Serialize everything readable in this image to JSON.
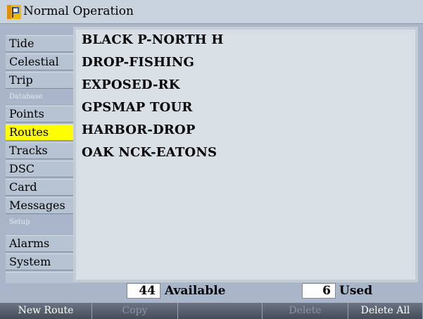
{
  "title": {
    "text": "Normal Operation",
    "icon": "garmin-flag-icon"
  },
  "sidebar": {
    "items": [
      {
        "label": "Tide",
        "selected": false
      },
      {
        "label": "Celestial",
        "selected": false
      },
      {
        "label": "Trip",
        "selected": false
      },
      {
        "header": "Database"
      },
      {
        "label": "Points",
        "selected": false
      },
      {
        "label": "Routes",
        "selected": true
      },
      {
        "label": "Tracks",
        "selected": false
      },
      {
        "label": "DSC",
        "selected": false
      },
      {
        "label": "Card",
        "selected": false
      },
      {
        "label": "Messages",
        "selected": false
      },
      {
        "header": "Setup"
      },
      {
        "label": "Alarms",
        "selected": false
      },
      {
        "label": "System",
        "selected": false
      }
    ]
  },
  "routes": [
    "BLACK P-NORTH H",
    "DROP-FISHING",
    "EXPOSED-RK",
    "GPSMAP TOUR",
    "HARBOR-DROP",
    "OAK NCK-EATONS"
  ],
  "status": {
    "available_count": "44",
    "available_label": "Available",
    "used_count": "6",
    "used_label": "Used"
  },
  "softkeys": [
    {
      "label": "New Route",
      "enabled": true
    },
    {
      "label": "Copy",
      "enabled": false
    },
    {
      "label": "",
      "enabled": false
    },
    {
      "label": "Delete",
      "enabled": false
    },
    {
      "label": "Delete All",
      "enabled": true
    }
  ],
  "colors": {
    "selected_tab": "#ffff00",
    "list_background": "#d8e0e6",
    "frame_background": "#a9b6c9",
    "softkey_bar": "#454c59"
  }
}
